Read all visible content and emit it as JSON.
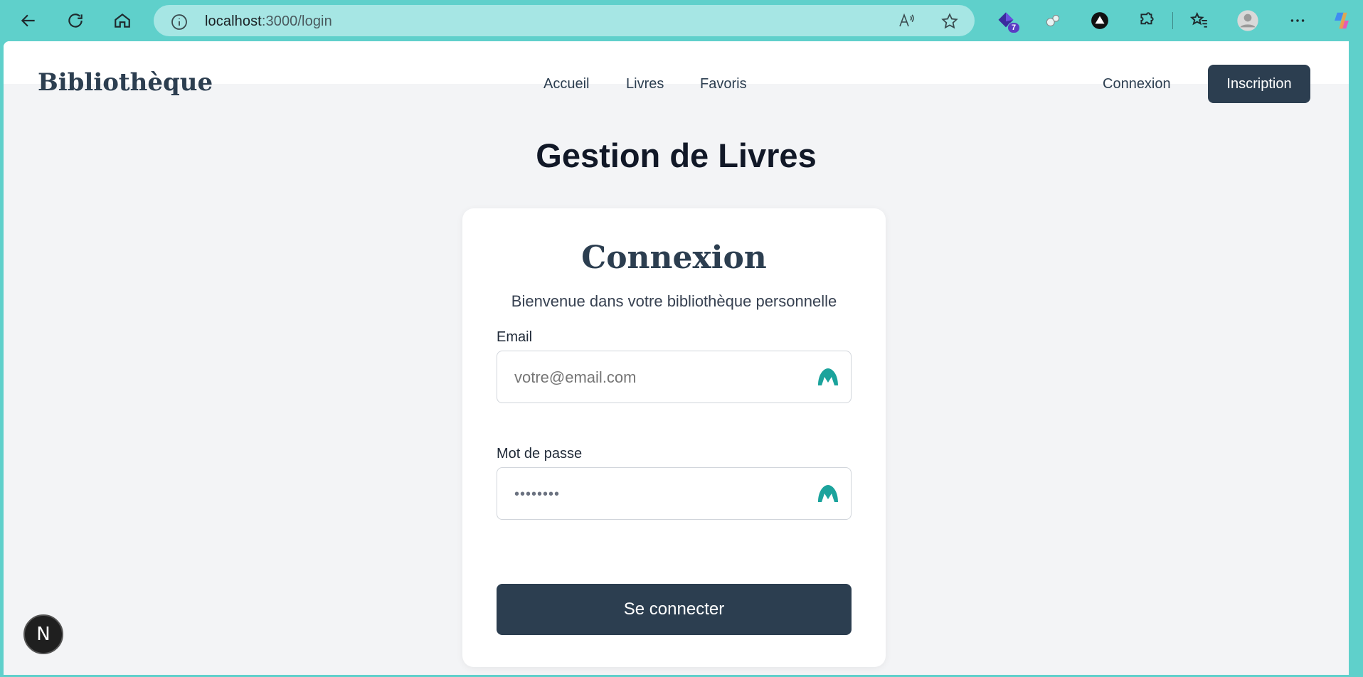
{
  "browser": {
    "url_host": "localhost",
    "url_rest": ":3000/login",
    "extension_badge": "7",
    "icons": [
      "back-icon",
      "refresh-icon",
      "home-icon",
      "info-icon",
      "read-aloud-icon",
      "favorite-star-icon",
      "extension-icon",
      "puzzle-icon",
      "favorites-icon",
      "profile-icon",
      "more-icon",
      "copilot-icon"
    ]
  },
  "navbar": {
    "brand": "Bibliothèque",
    "links": [
      "Accueil",
      "Livres",
      "Favoris"
    ],
    "login_label": "Connexion",
    "signup_label": "Inscription"
  },
  "page": {
    "title": "Gestion de Livres"
  },
  "login_card": {
    "title": "Connexion",
    "subtitle": "Bienvenue dans votre bibliothèque personnelle",
    "email_label": "Email",
    "email_placeholder": "votre@email.com",
    "password_label": "Mot de passe",
    "password_value": "••••••••",
    "submit_label": "Se connecter"
  },
  "dev_badge": "N",
  "colors": {
    "chrome_bg": "#5fd0cb",
    "primary": "#2c3e50",
    "page_bg": "#f3f4f6",
    "field_icon": "#1ba39c"
  }
}
